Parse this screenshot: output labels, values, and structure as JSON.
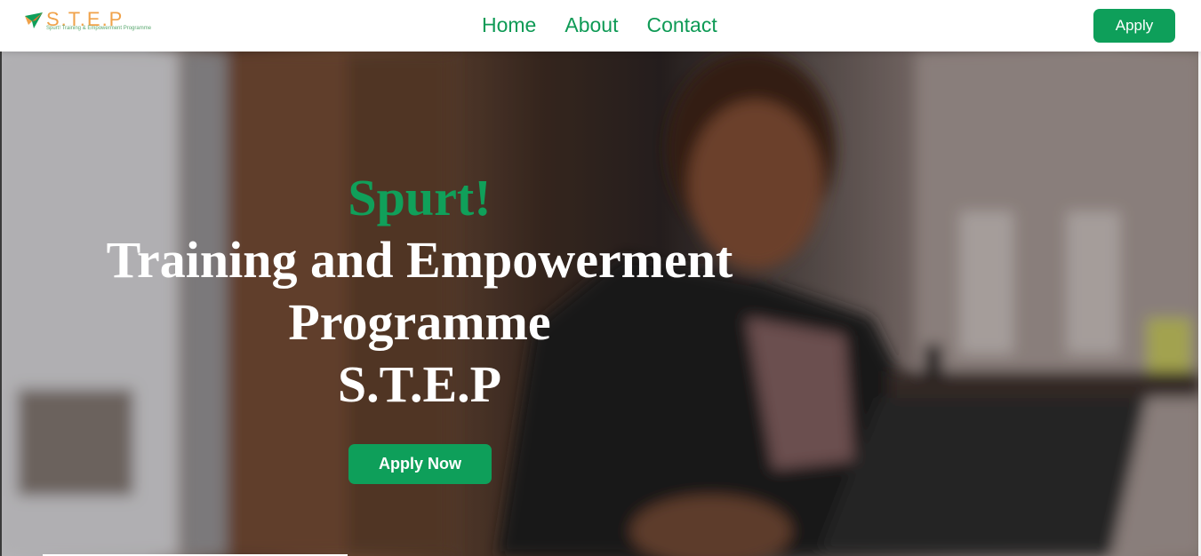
{
  "nav": {
    "logo_title": "S.T.E.P",
    "logo_subtitle": "Spurt! Training & Empowerment Programme",
    "links": [
      "Home",
      "About",
      "Contact"
    ],
    "apply_label": "Apply"
  },
  "hero": {
    "tagline": "Spurt!",
    "line1": "Training and Empowerment",
    "line2": "Programme",
    "line3": "S.T.E.P",
    "cta_label": "Apply Now"
  },
  "colors": {
    "brand_green": "#0e9f5a",
    "logo_orange": "#f0a24a",
    "text_white": "#ffffff"
  },
  "icons": {
    "logo": "plane-arrow-icon"
  }
}
